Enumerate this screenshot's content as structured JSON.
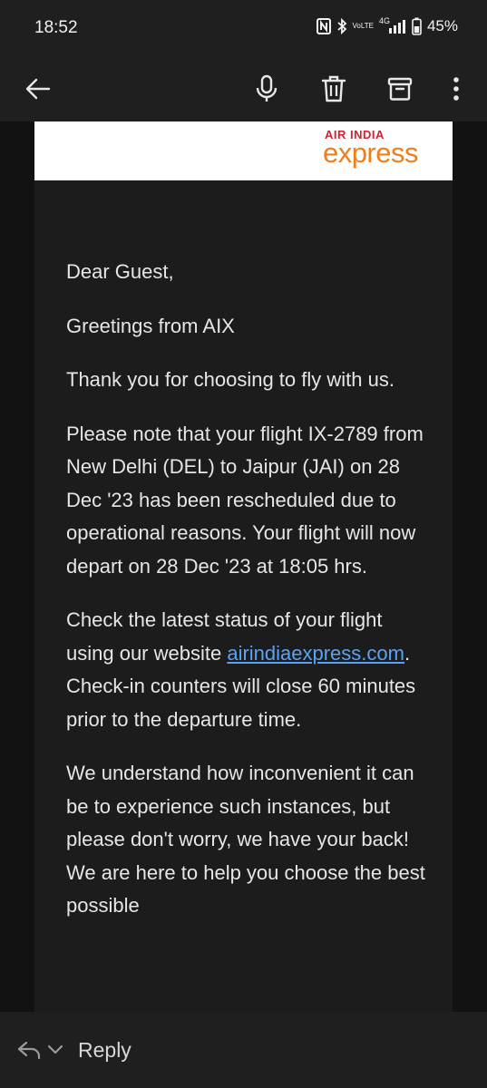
{
  "status_bar": {
    "time": "18:52",
    "battery": "45%",
    "net_label": "4G",
    "volte_top": "Vo",
    "volte_bottom": "LTE"
  },
  "app_bar": {
    "icons": [
      "back-arrow-icon",
      "microphone-icon",
      "delete-icon",
      "archive-icon",
      "more-vert-icon"
    ]
  },
  "banner": {
    "logo_top": "AIR INDIA",
    "logo_bottom": "express",
    "logo_colors": {
      "top": "#d2222d",
      "bottom": "#ef7f1a"
    }
  },
  "email": {
    "greeting": "Dear Guest,",
    "line2": "Greetings from AIX",
    "line3": "Thank you for choosing to fly with us.",
    "line4": "Please note that your flight IX-2789 from New Delhi (DEL) to Jaipur (JAI) on 28 Dec '23 has been rescheduled due to operational reasons. Your flight will now depart on 28 Dec '23 at 18:05 hrs.",
    "line5_before": "Check the latest status of your flight using our website ",
    "line5_link": "airindiaexpress.com",
    "line5_after": ". Check-in counters will close 60 minutes prior to the departure time.",
    "line6": "We understand how inconvenient it can be to experience such instances, but please don't worry, we have your back! We are here to help you choose the best possible"
  },
  "reply_bar": {
    "reply_label": "Reply"
  },
  "colors": {
    "background": "#121212",
    "bars": "#1f1f1f",
    "panel": "#1c1c1c",
    "link": "#5aa2f5"
  }
}
